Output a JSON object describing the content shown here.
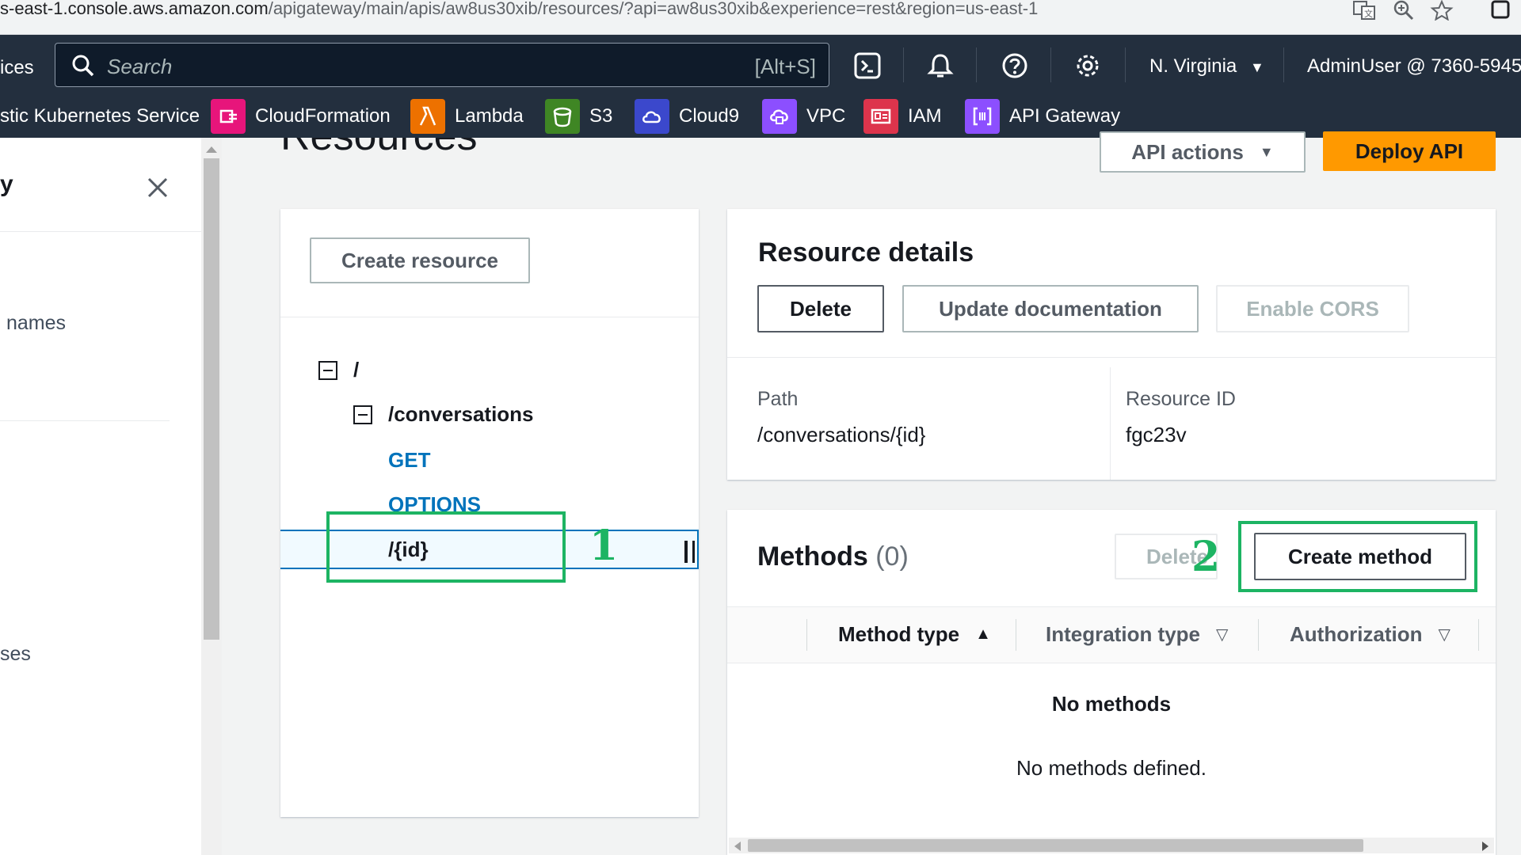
{
  "browser": {
    "url_host": "s-east-1.console.aws.amazon.com",
    "url_path": "/apigateway/main/apis/aw8us30xib/resources/?api=aw8us30xib&experience=rest&region=us-east-1"
  },
  "header": {
    "services_label_partial": "ices",
    "search_placeholder": "Search",
    "search_shortcut": "[Alt+S]",
    "region": "N. Virginia",
    "user": "AdminUser @ 7360-5945-"
  },
  "service_bar": [
    {
      "label": "stic Kubernetes Service",
      "icon": "eks-icon",
      "color": ""
    },
    {
      "label": "CloudFormation",
      "icon": "cloudformation-icon",
      "color": "#e7157b"
    },
    {
      "label": "Lambda",
      "icon": "lambda-icon",
      "color": "#ed7100"
    },
    {
      "label": "S3",
      "icon": "s3-icon",
      "color": "#3f8624"
    },
    {
      "label": "Cloud9",
      "icon": "cloud9-icon",
      "color": "#3b48cc"
    },
    {
      "label": "VPC",
      "icon": "vpc-icon",
      "color": "#8c4fff"
    },
    {
      "label": "IAM",
      "icon": "iam-icon",
      "color": "#dd344c"
    },
    {
      "label": "API Gateway",
      "icon": "api-gateway-icon",
      "color": "#8c4fff"
    }
  ],
  "leftnav": {
    "title_partial": "y",
    "item_names_partial": "names",
    "item_uses_partial": "ses"
  },
  "page": {
    "title": "Resources",
    "api_actions_label": "API actions",
    "deploy_label": "Deploy API"
  },
  "resource_tree": {
    "create_resource_label": "Create resource",
    "root": "/",
    "conversations": "/conversations",
    "method_get": "GET",
    "method_options": "OPTIONS",
    "id_resource": "/{id}"
  },
  "resource_details": {
    "heading": "Resource details",
    "delete_label": "Delete",
    "update_docs_label": "Update documentation",
    "enable_cors_label": "Enable CORS",
    "path_label": "Path",
    "path_value": "/conversations/{id}",
    "resource_id_label": "Resource ID",
    "resource_id_value": "fgc23v"
  },
  "methods": {
    "heading": "Methods",
    "count": "(0)",
    "delete_label": "Delete",
    "create_label": "Create method",
    "col_method_type": "Method type",
    "col_integration_type": "Integration type",
    "col_authorization": "Authorization",
    "empty_title": "No methods",
    "empty_desc": "No methods defined."
  },
  "annotations": {
    "step1": "1",
    "step2": "2",
    "color": "#1db463"
  }
}
